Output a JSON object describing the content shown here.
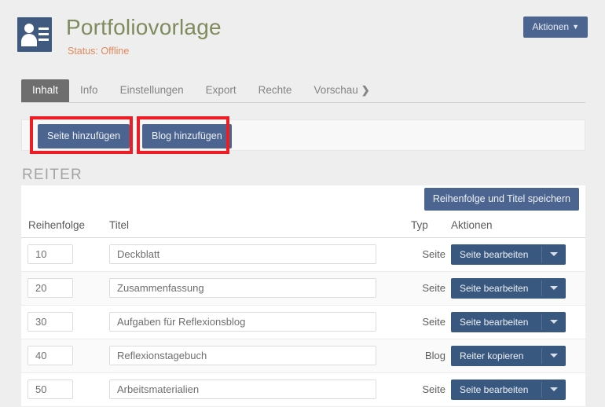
{
  "header": {
    "icon": "contact-card-icon",
    "title": "Portfoliovorlage",
    "status": "Status: Offline",
    "actions_button": "Aktionen",
    "actions_caret": "▼"
  },
  "tabs": [
    {
      "label": "Inhalt",
      "active": true
    },
    {
      "label": "Info",
      "active": false
    },
    {
      "label": "Einstellungen",
      "active": false
    },
    {
      "label": "Export",
      "active": false
    },
    {
      "label": "Rechte",
      "active": false
    },
    {
      "label": "Vorschau",
      "active": false,
      "chevron": "❯"
    }
  ],
  "toolbar": {
    "add_page_label": "Seite hinzufügen",
    "add_blog_label": "Blog hinzufügen"
  },
  "annotations": {
    "color": "#ee1c25",
    "boxes": [
      "add-page-button",
      "add-blog-button"
    ]
  },
  "section": {
    "title": "REITER",
    "save_button": "Reihenfolge und Titel speichern"
  },
  "table": {
    "columns": {
      "order": "Reihenfolge",
      "title": "Titel",
      "type": "Typ",
      "actions": "Aktionen"
    },
    "rows": [
      {
        "order": "10",
        "title": "Deckblatt",
        "type": "Seite",
        "action": "Seite bearbeiten"
      },
      {
        "order": "20",
        "title": "Zusammenfassung",
        "type": "Seite",
        "action": "Seite bearbeiten"
      },
      {
        "order": "30",
        "title": "Aufgaben für Reflexionsblog",
        "type": "Seite",
        "action": "Seite bearbeiten"
      },
      {
        "order": "40",
        "title": "Reflexionstagebuch",
        "type": "Blog",
        "action": "Reiter kopieren"
      },
      {
        "order": "50",
        "title": "Arbeitsmaterialien",
        "type": "Seite",
        "action": "Seite bearbeiten"
      }
    ]
  },
  "colors": {
    "page_background": "#eeeeee",
    "brand_blue": "#40597f",
    "button_blue": "#4c6590",
    "action_button_blue": "#39587f",
    "title_green": "#7e8b5c",
    "status_orange": "#e08a5c",
    "active_tab_gray": "#6e6e6e",
    "annotation_red": "#ee1c25"
  }
}
